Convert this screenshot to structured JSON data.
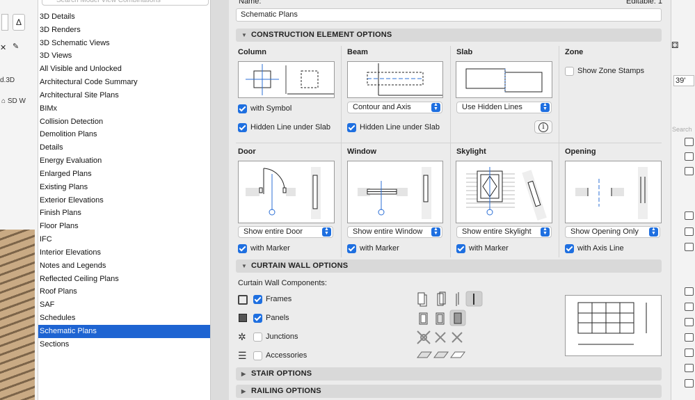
{
  "left_strip": {
    "file": "d.3D",
    "tab": "SD W"
  },
  "search": {
    "placeholder": "Search Model View Combinations"
  },
  "list": [
    "3D Details",
    "3D Renders",
    "3D Schematic Views",
    "3D Views",
    "All Visible and Unlocked",
    "Architectural Code Summary",
    "Architectural Site Plans",
    "BIMx",
    "Collision Detection",
    "Demolition Plans",
    "Details",
    "Energy Evaluation",
    "Enlarged Plans",
    "Existing Plans",
    "Exterior Elevations",
    "Finish Plans",
    "Floor Plans",
    "IFC",
    "Interior Elevations",
    "Notes and Legends",
    "Reflected Ceiling Plans",
    "Roof Plans",
    "SAF",
    "Schedules",
    "Schematic Plans",
    "Sections"
  ],
  "selected": "Schematic Plans",
  "header": {
    "name_label": "Name:",
    "editable": "Editable: 1",
    "name_value": "Schematic Plans"
  },
  "sections": {
    "construction": "CONSTRUCTION ELEMENT OPTIONS",
    "curtain": "CURTAIN WALL OPTIONS",
    "stair": "STAIR OPTIONS",
    "railing": "RAILING OPTIONS"
  },
  "column": {
    "title": "Column",
    "with_symbol": "with Symbol",
    "hidden_line": "Hidden Line under Slab"
  },
  "beam": {
    "title": "Beam",
    "select": "Contour and Axis",
    "hidden_line": "Hidden Line under Slab"
  },
  "slab": {
    "title": "Slab",
    "select": "Use Hidden Lines"
  },
  "zone": {
    "title": "Zone",
    "stamps": "Show Zone Stamps"
  },
  "door": {
    "title": "Door",
    "select": "Show entire Door",
    "marker": "with Marker"
  },
  "window": {
    "title": "Window",
    "select": "Show entire Window",
    "marker": "with Marker"
  },
  "skylight": {
    "title": "Skylight",
    "select": "Show entire Skylight",
    "marker": "with Marker"
  },
  "opening": {
    "title": "Opening",
    "select": "Show Opening Only",
    "axis": "with Axis Line"
  },
  "curtain": {
    "components_label": "Curtain Wall Components:",
    "frames": "Frames",
    "panels": "Panels",
    "junctions": "Junctions",
    "accessories": "Accessories"
  },
  "right_strip": {
    "value": "39'",
    "search": "Search"
  },
  "colors": {
    "accent": "#1e6fe0",
    "selection": "#1e64d2"
  }
}
